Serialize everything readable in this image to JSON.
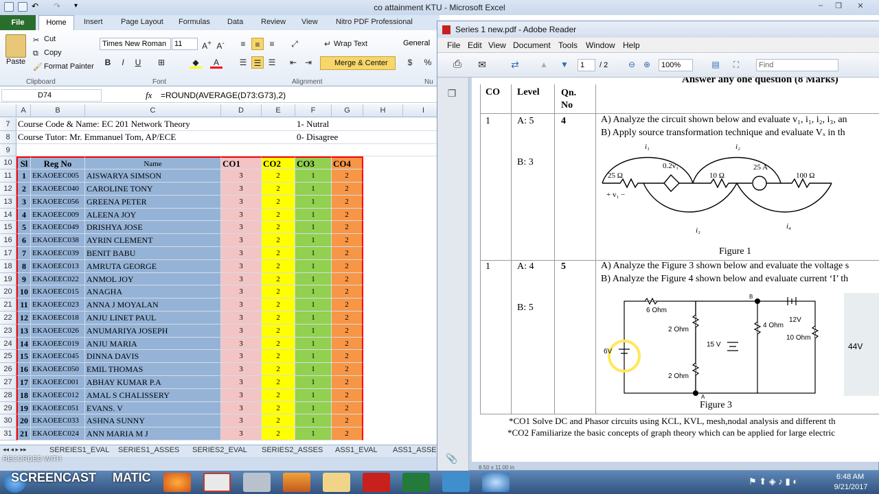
{
  "excel": {
    "title": "co attainment KTU  -  Microsoft Excel",
    "ribbon_tabs": [
      "File",
      "Home",
      "Insert",
      "Page Layout",
      "Formulas",
      "Data",
      "Review",
      "View",
      "Nitro PDF Professional"
    ],
    "clipboard": {
      "paste": "Paste",
      "cut": "Cut",
      "copy": "Copy",
      "format_painter": "Format Painter",
      "group": "Clipboard"
    },
    "font": {
      "name": "Times New Roman",
      "size": "11",
      "group": "Font"
    },
    "alignment": {
      "wrap": "Wrap Text",
      "merge": "Merge & Center",
      "group": "Alignment"
    },
    "number": {
      "format": "General",
      "group": "Nu"
    },
    "name_box": "D74",
    "fx": "fx",
    "formula": "=ROUND(AVERAGE(D73:G73),2)",
    "columns": [
      "A",
      "B",
      "C",
      "D",
      "E",
      "F",
      "G",
      "H",
      "I"
    ],
    "info_rows": [
      {
        "row": "7",
        "text": "Course Code & Name:  EC 201 Network Theory",
        "note": "1- Nutral"
      },
      {
        "row": "8",
        "text": "Course Tutor: Mr. Emmanuel Tom, AP/ECE",
        "note": "0- Disagree"
      },
      {
        "row": "9",
        "text": "",
        "note": ""
      }
    ],
    "table_header": {
      "row": "10",
      "sl": "Sl",
      "reg": "Reg No",
      "name": "Name",
      "co1": "CO1",
      "co2": "CO2",
      "co3": "CO3",
      "co4": "CO4"
    },
    "students": [
      {
        "row": "11",
        "sl": "1",
        "reg": "EKAOEEC005",
        "name": "AISWARYA SIMSON",
        "co1": "3",
        "co2": "2",
        "co3": "1",
        "co4": "2"
      },
      {
        "row": "12",
        "sl": "2",
        "reg": "EKAOEEC040",
        "name": "CAROLINE TONY",
        "co1": "3",
        "co2": "2",
        "co3": "1",
        "co4": "2"
      },
      {
        "row": "13",
        "sl": "3",
        "reg": "EKAOEEC056",
        "name": "GREENA PETER",
        "co1": "3",
        "co2": "2",
        "co3": "1",
        "co4": "2"
      },
      {
        "row": "14",
        "sl": "4",
        "reg": "EKAOEEC009",
        "name": "ALEENA JOY",
        "co1": "3",
        "co2": "2",
        "co3": "1",
        "co4": "2"
      },
      {
        "row": "15",
        "sl": "5",
        "reg": "EKAOEEC049",
        "name": "DRISHYA JOSE",
        "co1": "3",
        "co2": "2",
        "co3": "1",
        "co4": "2"
      },
      {
        "row": "16",
        "sl": "6",
        "reg": "EKAOEEC038",
        "name": "AYRIN CLEMENT",
        "co1": "3",
        "co2": "2",
        "co3": "1",
        "co4": "2"
      },
      {
        "row": "17",
        "sl": "7",
        "reg": "EKAOEEC039",
        "name": "BENIT BABU",
        "co1": "3",
        "co2": "2",
        "co3": "1",
        "co4": "2"
      },
      {
        "row": "18",
        "sl": "8",
        "reg": "EKAOEEC013",
        "name": "AMRUTA GEORGE",
        "co1": "3",
        "co2": "2",
        "co3": "1",
        "co4": "2"
      },
      {
        "row": "19",
        "sl": "9",
        "reg": "EKAOEEC022",
        "name": "ANMOL JOY",
        "co1": "3",
        "co2": "2",
        "co3": "1",
        "co4": "2"
      },
      {
        "row": "20",
        "sl": "10",
        "reg": "EKAOEEC015",
        "name": "ANAGHA",
        "co1": "3",
        "co2": "2",
        "co3": "1",
        "co4": "2"
      },
      {
        "row": "21",
        "sl": "11",
        "reg": "EKAOEEC023",
        "name": "ANNA J MOYALAN",
        "co1": "3",
        "co2": "2",
        "co3": "1",
        "co4": "2"
      },
      {
        "row": "22",
        "sl": "12",
        "reg": "EKAOEEC018",
        "name": "ANJU LINET PAUL",
        "co1": "3",
        "co2": "2",
        "co3": "1",
        "co4": "2"
      },
      {
        "row": "23",
        "sl": "13",
        "reg": "EKAOEEC026",
        "name": "ANUMARIYA JOSEPH",
        "co1": "3",
        "co2": "2",
        "co3": "1",
        "co4": "2"
      },
      {
        "row": "24",
        "sl": "14",
        "reg": "EKAOEEC019",
        "name": "ANJU MARIA",
        "co1": "3",
        "co2": "2",
        "co3": "1",
        "co4": "2"
      },
      {
        "row": "25",
        "sl": "15",
        "reg": "EKAOEEC045",
        "name": "DINNA DAVIS",
        "co1": "3",
        "co2": "2",
        "co3": "1",
        "co4": "2"
      },
      {
        "row": "26",
        "sl": "16",
        "reg": "EKAOEEC050",
        "name": "EMIL THOMAS",
        "co1": "3",
        "co2": "2",
        "co3": "1",
        "co4": "2"
      },
      {
        "row": "27",
        "sl": "17",
        "reg": "EKAOEEC001",
        "name": "ABHAY KUMAR P.A",
        "co1": "3",
        "co2": "2",
        "co3": "1",
        "co4": "2"
      },
      {
        "row": "28",
        "sl": "18",
        "reg": "EKAOEEC012",
        "name": "AMAL S CHALISSERY",
        "co1": "3",
        "co2": "2",
        "co3": "1",
        "co4": "2"
      },
      {
        "row": "29",
        "sl": "19",
        "reg": "EKAOEEC051",
        "name": "EVANS. V",
        "co1": "3",
        "co2": "2",
        "co3": "1",
        "co4": "2"
      },
      {
        "row": "30",
        "sl": "20",
        "reg": "EKAOEEC033",
        "name": "ASHNA SUNNY",
        "co1": "3",
        "co2": "2",
        "co3": "1",
        "co4": "2"
      },
      {
        "row": "31",
        "sl": "21",
        "reg": "EKAOEEC024",
        "name": "ANN MARIA M J",
        "co1": "3",
        "co2": "2",
        "co3": "1",
        "co4": "2"
      }
    ],
    "sheet_tabs": [
      "SEREIES1_EVAL",
      "SERIES1_ASSES",
      "SERIES2_EVAL",
      "SERIES2_ASSES",
      "ASS1_EVAL",
      "ASS1_ASSE"
    ],
    "status": "RECORDED WITH"
  },
  "adobe": {
    "title": "Series 1 new.pdf - Adobe Reader",
    "menu": [
      "File",
      "Edit",
      "View",
      "Document",
      "Tools",
      "Window",
      "Help"
    ],
    "page_current": "1",
    "page_total": "/ 2",
    "zoom": "100%",
    "find_placeholder": "Find",
    "doc": {
      "header_text": "Answer any one question (8 Marks)",
      "col_co": "CO",
      "col_level": "Level",
      "col_qn": "Qn.\nNo",
      "q1": {
        "co": "1",
        "level_a": "A: 5",
        "level_b": "B: 3",
        "qn": "4",
        "a": "A) Analyze the circuit shown below and evaluate v₁, i₁, i₂, i₃, an",
        "b": "B) Apply source transformation technique and evaluate Vₓ in th",
        "fig": "Figure 1"
      },
      "q2": {
        "co": "1",
        "level_a": "A: 4",
        "level_b": "B: 5",
        "qn": "5",
        "a": "A) Analyze the Figure 3 shown below and evaluate the voltage s",
        "b": "B) Analyze the Figure 4 shown below and evaluate current ‘I’ th",
        "fig": "Figure 3"
      },
      "foot1": "*CO1 Solve DC and Phasor circuits using KCL, KVL, mesh,nodal analysis and different th",
      "foot2": "*CO2 Familiarize the basic concepts of graph theory which can be applied for large electric",
      "circuit1": {
        "r1": "25 Ω",
        "src": "0.2v₁",
        "r2": "10 Ω",
        "cs": "25 A",
        "r3": "100 Ω",
        "i1": "i₁",
        "i2": "i₂",
        "i3": "i₃",
        "i4": "i₄",
        "v1": "+  v₁  −"
      },
      "circuit3": {
        "r6": "6 Ohm",
        "r2a": "2 Ohm",
        "r2b": "2 Ohm",
        "v15": "15 V",
        "v6": "6V",
        "r4": "4 Ohm",
        "v12": "12V",
        "r10": "10 Ohm",
        "b": "B",
        "a": "A",
        "hw": "44V"
      }
    },
    "page_size": "8.50 x 11.00 in"
  },
  "taskbar": {
    "time": "6:48 AM",
    "date": "9/21/2017",
    "screencast": "SCREENCAST",
    "matic": "MATIC",
    "recorded": "RECORDED WITH"
  },
  "colors": {
    "co1": "#f2c4c4",
    "co2": "#ffff00",
    "co3": "#92d050",
    "co4": "#f79646",
    "blue": "#95b3d7",
    "red_border": "#ff0000",
    "file_tab": "#2a6e2e"
  }
}
